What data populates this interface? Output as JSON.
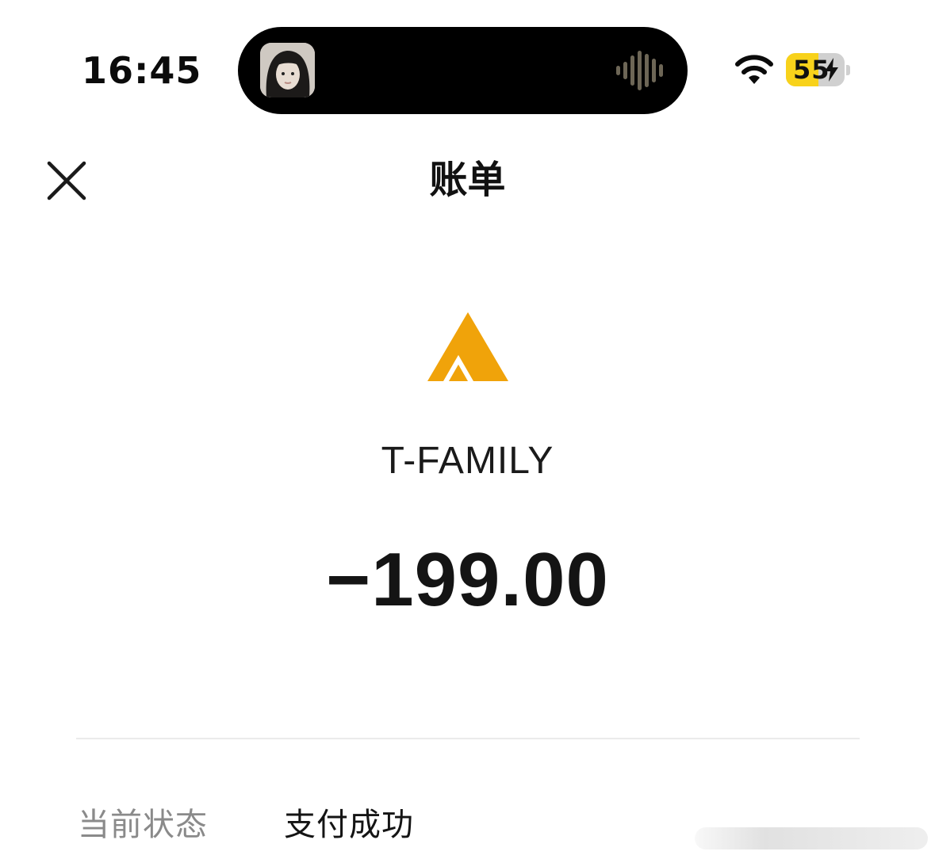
{
  "status_bar": {
    "time": "16:45",
    "battery_percent": "55",
    "battery_level": 0.55,
    "charging": true,
    "wifi_icon": "wifi-icon",
    "island_icons": [
      "avatar-thumbnail",
      "audio-waveform-icon"
    ]
  },
  "nav": {
    "title": "账单",
    "close_icon": "close-icon"
  },
  "merchant": {
    "logo_icon": "merchant-triangle-logo",
    "logo_color": "#F0A30A",
    "name": "T-FAMILY"
  },
  "transaction": {
    "amount": "−199.00"
  },
  "details": {
    "status_label": "当前状态",
    "status_value": "支付成功"
  },
  "colors": {
    "accent_battery": "#F8D21B",
    "label_gray": "#8A8A8A",
    "text_dark": "#141414"
  }
}
